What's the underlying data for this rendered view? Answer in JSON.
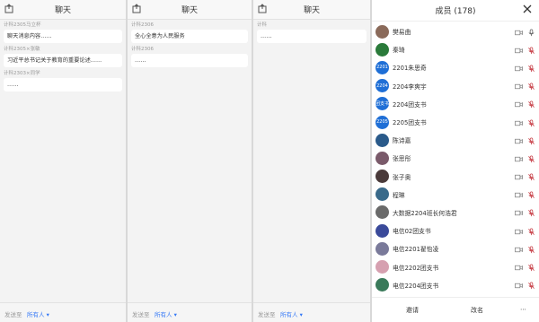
{
  "chat_title": "聊天",
  "footer": {
    "send_label": "发送至",
    "target": "所有人 ▾"
  },
  "panel1": {
    "messages": [
      {
        "sender": "计科2305马立杯",
        "text": "聊天消息内容……"
      },
      {
        "sender": "计科2305×张敏",
        "text": "习近平总书记关于教育的重要论述……"
      },
      {
        "sender": "计科2303×同学",
        "text": "……"
      }
    ]
  },
  "panel2": {
    "messages": [
      {
        "sender": "计科2306",
        "text": "全心全意为人民服务"
      },
      {
        "sender": "计科2306",
        "text": "……"
      }
    ]
  },
  "panel3": {
    "messages": [
      {
        "sender": "计科",
        "text": "……"
      }
    ]
  },
  "members": {
    "title": "成员 (178)",
    "list": [
      {
        "name": "樊易曲",
        "avatar_color": "#8a6a5a",
        "avatar_text": "",
        "mic_on": true
      },
      {
        "name": "秦琦",
        "avatar_color": "#2a7a3a",
        "avatar_text": "",
        "mic_on": false
      },
      {
        "name": "2201朱思奇",
        "avatar_color": "#1f6fd6",
        "avatar_text": "2201",
        "mic_on": false
      },
      {
        "name": "2204李爽宇",
        "avatar_color": "#1f6fd6",
        "avatar_text": "2204",
        "mic_on": false
      },
      {
        "name": "2204团支书",
        "avatar_color": "#1f6fd6",
        "avatar_text": "团支书",
        "mic_on": false
      },
      {
        "name": "2205团支书",
        "avatar_color": "#1f6fd6",
        "avatar_text": "2205",
        "mic_on": false
      },
      {
        "name": "陈诗嘉",
        "avatar_color": "#2a5a8a",
        "avatar_text": "",
        "mic_on": false
      },
      {
        "name": "张思彤",
        "avatar_color": "#7a5a6a",
        "avatar_text": "",
        "mic_on": false
      },
      {
        "name": "张子奥",
        "avatar_color": "#4a3a3a",
        "avatar_text": "",
        "mic_on": false
      },
      {
        "name": "程琳",
        "avatar_color": "#3a6a8a",
        "avatar_text": "",
        "mic_on": false
      },
      {
        "name": "大数据2204班长何浩君",
        "avatar_color": "#6a6a6a",
        "avatar_text": "",
        "mic_on": false
      },
      {
        "name": "电信02团支书",
        "avatar_color": "#3a4a9a",
        "avatar_text": "",
        "mic_on": false
      },
      {
        "name": "电信2201翟怡凌",
        "avatar_color": "#7a7a9a",
        "avatar_text": "",
        "mic_on": false
      },
      {
        "name": "电信2202团支书",
        "avatar_color": "#d6a0b0",
        "avatar_text": "",
        "mic_on": false
      },
      {
        "name": "电信2204团支书",
        "avatar_color": "#3a7a5a",
        "avatar_text": "",
        "mic_on": false
      }
    ],
    "invite_label": "邀请",
    "rename_label": "改名",
    "more_label": "⋯"
  }
}
